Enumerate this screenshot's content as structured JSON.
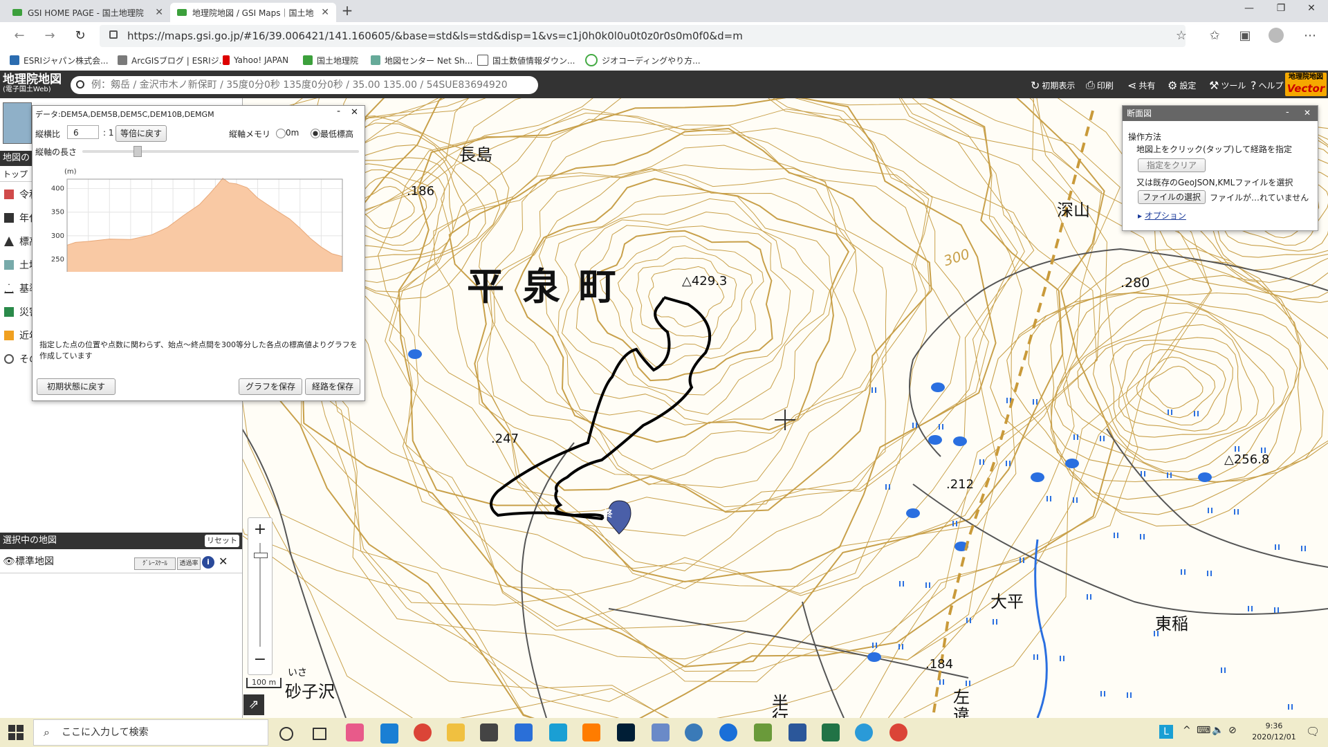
{
  "browser": {
    "tabs": [
      {
        "title": "GSI HOME PAGE - 国土地理院"
      },
      {
        "title": "地理院地図 / GSI Maps｜国土地"
      }
    ],
    "url": "https://maps.gsi.go.jp/#16/39.006421/141.160605/&base=std&ls=std&disp=1&vs=c1j0h0k0l0u0t0z0r0s0m0f0&d=m",
    "bookmarks": [
      "ESRIジャパン株式会...",
      "ArcGISブログ | ESRIジ...",
      "Yahoo! JAPAN",
      "国土地理院",
      "地図センター Net Sh...",
      "国土数値情報ダウン...",
      "ジオコーディングやり方..."
    ]
  },
  "header": {
    "logo": "地理院地図",
    "logo_sub": "(電子国土Web)",
    "search_placeholder": "例：剱岳 / 金沢市木ノ新保町 / 35度0分0秒 135度0分0秒 / 35.00 135.00 / 54SUE83694920",
    "buttons": [
      "初期表示",
      "印刷",
      "共有",
      "設定",
      "ツール",
      "ヘルプ"
    ],
    "vector_badge_top": "地理院地図",
    "vector_badge": "Vector"
  },
  "left_panel": {
    "title": "地図の",
    "tab": "トップ",
    "items": [
      "令和",
      "年代",
      "標高",
      "土地",
      "基準",
      "災害",
      "近年",
      "その"
    ],
    "selected_header": "選択中の地図",
    "reset": "リセット",
    "selected_map": "標準地図",
    "gray": "ｸﾞﾚｰｽｹｰﾙ",
    "opacity": "透過率",
    "info": "i"
  },
  "profile_dialog": {
    "data_label": "データ:DEM5A,DEM5B,DEM5C,DEM10B,DEMGM",
    "ratio_label": "縦横比",
    "ratio_value": "6",
    "ratio_suffix": ": 1",
    "equal_btn": "等倍に戻す",
    "axis_memo": "縦軸メモリ",
    "opt_0m": "0m",
    "opt_min": "最低標高",
    "axis_length": "縦軸の長さ",
    "note": "指定した点の位置や点数に関わらず、始点～終点間を300等分した各点の標高値よりグラフを作成しています",
    "reset_btn": "初期状態に戻す",
    "save_graph": "グラフを保存",
    "save_route": "経路を保存"
  },
  "chart_data": {
    "type": "area",
    "title": "",
    "xlabel": "(m)",
    "ylabel": "(m)",
    "xlim": [
      0,
      2600
    ],
    "ylim": [
      200,
      420
    ],
    "xticks": [
      0,
      200,
      400,
      600,
      800,
      1000,
      1200,
      1400,
      1600,
      1800,
      2000,
      2200,
      2400,
      2600
    ],
    "yticks": [
      200,
      250,
      300,
      350,
      400
    ],
    "x": [
      0,
      80,
      200,
      400,
      600,
      800,
      950,
      1100,
      1250,
      1350,
      1420,
      1470,
      1530,
      1600,
      1700,
      1800,
      1900,
      2000,
      2100,
      2200,
      2300,
      2400,
      2500,
      2600
    ],
    "y": [
      280,
      286,
      288,
      293,
      292,
      302,
      318,
      343,
      366,
      390,
      408,
      422,
      412,
      410,
      402,
      380,
      365,
      350,
      336,
      316,
      294,
      276,
      262,
      256
    ],
    "grid": true,
    "color": "#f9c9a4"
  },
  "cross_section": {
    "title": "断面図",
    "heading": "操作方法",
    "instruction": "地図上をクリック(タップ)して経路を指定",
    "clear_btn": "指定をクリア",
    "or_text": "又は既存のGeoJSON,KMLファイルを選択",
    "file_btn": "ファイルの選択",
    "file_status": "ファイルが…れていません",
    "options": "オプション"
  },
  "map_labels": {
    "town": "平 泉 町",
    "nagashima": "長島",
    "fukayama": "深山",
    "ohira": "大平",
    "higashiine": "東稲",
    "isagozawa": "砂子沢",
    "isa": "いさ",
    "hangyo": "半",
    "hangyo2": "行",
    "hidari": "左",
    "hidari2": "違",
    "e186": ".186",
    "e429": "429.3",
    "e280": ".280",
    "e247": ".247",
    "e256": "256.8",
    "e212": ".212",
    "e184": ".184",
    "c300": "300",
    "marker": "終",
    "scale": "100 m"
  },
  "zoom": {
    "plus": "+",
    "minus": "−"
  },
  "taskbar": {
    "search_placeholder": "ここに入力して検索",
    "time": "9:36",
    "date": "2020/12/01",
    "ime": "L"
  },
  "colors": {
    "contour": "#c8a04a",
    "route": "#000000",
    "water": "#2a6fe0",
    "header_bg": "#333333"
  }
}
